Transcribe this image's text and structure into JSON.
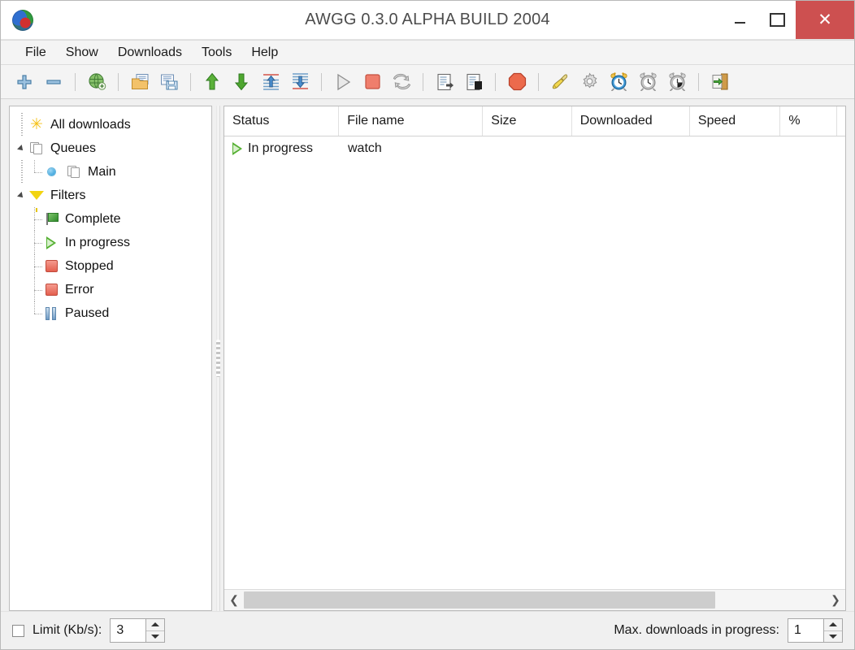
{
  "window": {
    "title": "AWGG 0.3.0 ALPHA BUILD 2004",
    "app_icon": "globe-icon",
    "controls": {
      "minimize": "minimize-icon",
      "maximize": "maximize-icon",
      "close": "✕"
    },
    "close_color": "#cd5050"
  },
  "menubar": {
    "items": [
      {
        "label": "File"
      },
      {
        "label": "Show"
      },
      {
        "label": "Downloads"
      },
      {
        "label": "Tools"
      },
      {
        "label": "Help"
      }
    ]
  },
  "toolbar": {
    "buttons": [
      {
        "name": "add-download-icon",
        "kind": "plus"
      },
      {
        "name": "remove-download-icon",
        "kind": "minus"
      },
      {
        "name": "separator",
        "kind": "sep"
      },
      {
        "name": "add-url-globe-icon",
        "kind": "globe"
      },
      {
        "name": "separator",
        "kind": "sep"
      },
      {
        "name": "import-list-icon",
        "kind": "import"
      },
      {
        "name": "export-list-icon",
        "kind": "export"
      },
      {
        "name": "separator",
        "kind": "sep"
      },
      {
        "name": "move-up-icon",
        "kind": "arrow-up"
      },
      {
        "name": "move-down-icon",
        "kind": "arrow-down"
      },
      {
        "name": "move-to-top-icon",
        "kind": "to-top"
      },
      {
        "name": "move-to-bottom-icon",
        "kind": "to-bottom"
      },
      {
        "name": "separator",
        "kind": "sep"
      },
      {
        "name": "start-download-icon",
        "kind": "play"
      },
      {
        "name": "stop-download-icon",
        "kind": "stop-square"
      },
      {
        "name": "refresh-icon",
        "kind": "refresh"
      },
      {
        "name": "separator",
        "kind": "sep"
      },
      {
        "name": "properties-icon",
        "kind": "doc-arrow"
      },
      {
        "name": "log-icon",
        "kind": "doc-black"
      },
      {
        "name": "separator",
        "kind": "sep"
      },
      {
        "name": "stop-all-icon",
        "kind": "stop-octagon"
      },
      {
        "name": "separator",
        "kind": "sep"
      },
      {
        "name": "clean-list-icon",
        "kind": "broom"
      },
      {
        "name": "options-icon",
        "kind": "gear"
      },
      {
        "name": "scheduler-icon",
        "kind": "clock-blue"
      },
      {
        "name": "timer-start-icon",
        "kind": "clock-gray"
      },
      {
        "name": "timer-stop-icon",
        "kind": "clock-gray-half"
      },
      {
        "name": "separator",
        "kind": "sep"
      },
      {
        "name": "exit-icon",
        "kind": "exit"
      }
    ]
  },
  "sidebar": {
    "nodes": [
      {
        "label": "All downloads",
        "icon": "star-icon",
        "level": 0,
        "expander": "none",
        "guide": "stub"
      },
      {
        "label": "Queues",
        "icon": "queue-icon",
        "level": 0,
        "expander": "expanded",
        "guide": "none"
      },
      {
        "label": "Main",
        "icon": "queue-icon",
        "level": 1,
        "expander": "bullet",
        "guide": "elbow"
      },
      {
        "label": "Filters",
        "icon": "funnel-icon",
        "level": 0,
        "expander": "expanded",
        "guide": "none"
      },
      {
        "label": "Complete",
        "icon": "flag-icon",
        "level": 1,
        "expander": "none",
        "guide": "elbow-through"
      },
      {
        "label": "In progress",
        "icon": "play-icon",
        "level": 1,
        "expander": "none",
        "guide": "elbow-through"
      },
      {
        "label": "Stopped",
        "icon": "stop-icon",
        "level": 1,
        "expander": "none",
        "guide": "elbow-through"
      },
      {
        "label": "Error",
        "icon": "stop-icon",
        "level": 1,
        "expander": "none",
        "guide": "elbow-through"
      },
      {
        "label": "Paused",
        "icon": "pause-icon",
        "level": 1,
        "expander": "none",
        "guide": "elbow"
      }
    ]
  },
  "download_list": {
    "columns": [
      {
        "label": "Status",
        "width": 142
      },
      {
        "label": "File name",
        "width": 178
      },
      {
        "label": "Size",
        "width": 110
      },
      {
        "label": "Downloaded",
        "width": 146
      },
      {
        "label": "Speed",
        "width": 112
      },
      {
        "label": "%",
        "width": 70
      }
    ],
    "rows": [
      {
        "status": "In progress",
        "status_icon": "play-icon",
        "file_name": "watch",
        "size": "",
        "downloaded": "",
        "speed": "",
        "percent": ""
      }
    ],
    "hscroll": {
      "left_arrow": "❮",
      "right_arrow": "❯",
      "thumb_percent": 81
    }
  },
  "statusbar": {
    "limit_checked": false,
    "limit_label": "Limit (Kb/s):",
    "limit_value": "3",
    "max_downloads_label": "Max. downloads in progress:",
    "max_downloads_value": "1"
  }
}
